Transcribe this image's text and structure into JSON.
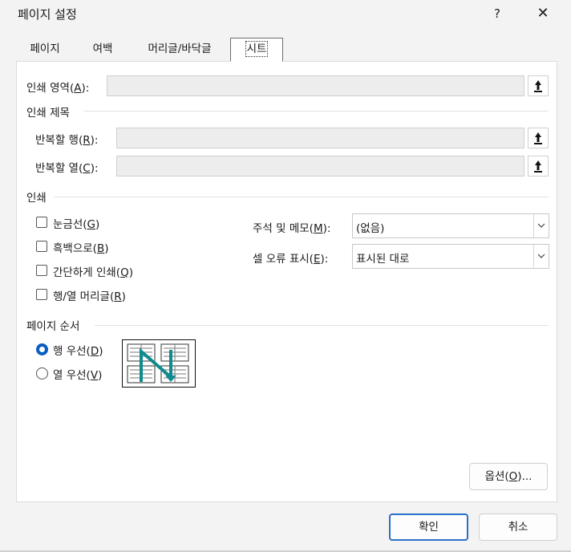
{
  "dialog": {
    "title": "페이지 설정",
    "help_glyph": "?",
    "close_glyph": "✕"
  },
  "tabs": [
    {
      "label": "페이지",
      "selected": false
    },
    {
      "label": "여백",
      "selected": false
    },
    {
      "label": "머리글/바닥글",
      "selected": false
    },
    {
      "label": "시트",
      "selected": true
    }
  ],
  "print_area": {
    "label": "인쇄 영역(",
    "key": "A",
    "suffix": "):",
    "value": "",
    "button_icon": "collapse-dialog-icon"
  },
  "print_titles": {
    "heading": "인쇄 제목",
    "rows": {
      "label": "반복할 행(",
      "key": "R",
      "suffix": "):",
      "value": ""
    },
    "cols": {
      "label": "반복할 열(",
      "key": "C",
      "suffix": "):",
      "value": ""
    }
  },
  "print": {
    "heading": "인쇄",
    "checkboxes": [
      {
        "label": "눈금선(",
        "key": "G",
        "suffix": ")",
        "checked": false
      },
      {
        "label": "흑백으로(",
        "key": "B",
        "suffix": ")",
        "checked": false
      },
      {
        "label": "간단하게 인쇄(",
        "key": "Q",
        "suffix": ")",
        "checked": false
      },
      {
        "label": "행/열 머리글(",
        "key": "R",
        "suffix": ")",
        "checked": false
      }
    ],
    "comments": {
      "label": "주석 및 메모(",
      "key": "M",
      "suffix": "):",
      "value": "(없음)"
    },
    "cell_errors": {
      "label": "셀 오류 표시(",
      "key": "E",
      "suffix": "):",
      "value": "표시된 대로"
    }
  },
  "page_order": {
    "heading": "페이지 순서",
    "options": [
      {
        "label": "행 우선(",
        "key": "D",
        "suffix": ")",
        "selected": true
      },
      {
        "label": "열 우선(",
        "key": "V",
        "suffix": ")",
        "selected": false
      }
    ],
    "preview_icon": "page-order-down-then-over-icon"
  },
  "buttons": {
    "options": {
      "label": "옵션(",
      "key": "O",
      "suffix": ")..."
    },
    "ok": "확인",
    "cancel": "취소"
  },
  "colors": {
    "accent": "#0a5dc2",
    "preview_arrow": "#0f8a8e"
  }
}
